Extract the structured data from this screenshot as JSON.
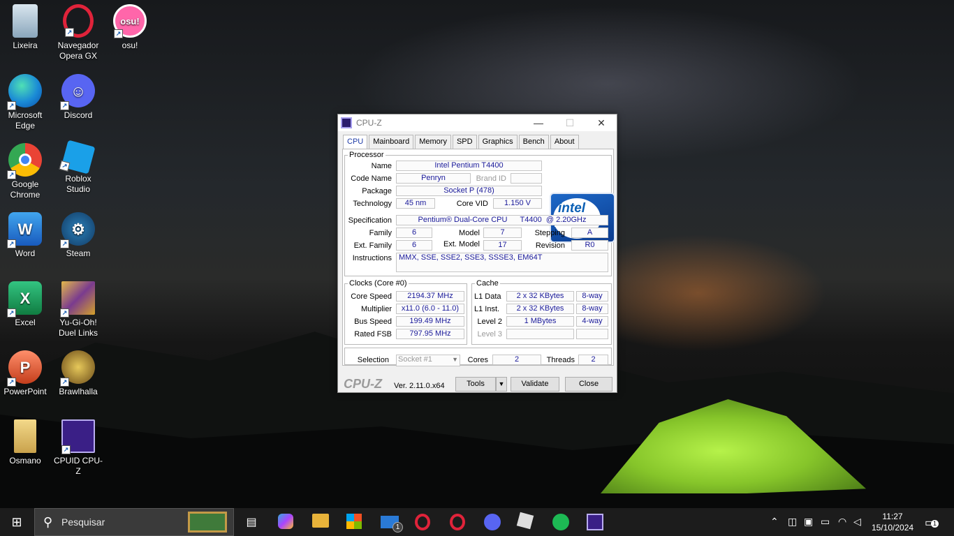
{
  "desktop": {
    "icons": [
      {
        "label": "Lixeira"
      },
      {
        "label": "Navegador Opera GX"
      },
      {
        "label": "osu!",
        "glyph": "osu!"
      },
      {
        "label": "Microsoft Edge"
      },
      {
        "label": "Discord"
      },
      {
        "label": "Google Chrome"
      },
      {
        "label": "Roblox Studio"
      },
      {
        "label": "Word",
        "glyph": "W"
      },
      {
        "label": "Steam"
      },
      {
        "label": "Excel",
        "glyph": "X"
      },
      {
        "label": "Yu-Gi-Oh! Duel Links"
      },
      {
        "label": "PowerPoint",
        "glyph": "P"
      },
      {
        "label": "Brawlhalla"
      },
      {
        "label": "Osmano"
      },
      {
        "label": "CPUID CPU-Z"
      }
    ]
  },
  "window": {
    "title": "CPU-Z",
    "controls": {
      "minimize": "—",
      "maximize": "☐",
      "close": "✕"
    },
    "tabs": [
      "CPU",
      "Mainboard",
      "Memory",
      "SPD",
      "Graphics",
      "Bench",
      "About"
    ],
    "processor": {
      "legend": "Processor",
      "name_label": "Name",
      "name": "Intel Pentium T4400",
      "codename_label": "Code Name",
      "codename": "Penryn",
      "brand_id_label": "Brand ID",
      "brand_id": "",
      "package_label": "Package",
      "package": "Socket P (478)",
      "technology_label": "Technology",
      "technology": "45 nm",
      "core_vid_label": "Core VID",
      "core_vid": "1.150 V",
      "spec_label": "Specification",
      "spec": "Pentium® Dual-Core CPU      T4400  @ 2.20GHz",
      "family_label": "Family",
      "family": "6",
      "model_label": "Model",
      "model": "7",
      "stepping_label": "Stepping",
      "stepping": "A",
      "ext_family_label": "Ext. Family",
      "ext_family": "6",
      "ext_model_label": "Ext. Model",
      "ext_model": "17",
      "revision_label": "Revision",
      "revision": "R0",
      "instructions_label": "Instructions",
      "instructions": "MMX, SSE, SSE2, SSE3, SSSE3, EM64T",
      "logo": {
        "line1": "intel",
        "line2": "Pentium",
        "line3": "inside",
        "color": "#0a5fb4"
      }
    },
    "clocks": {
      "legend": "Clocks (Core #0)",
      "core_speed_label": "Core Speed",
      "core_speed": "2194.37 MHz",
      "multiplier_label": "Multiplier",
      "multiplier": "x11.0 (6.0 - 11.0)",
      "bus_speed_label": "Bus Speed",
      "bus_speed": "199.49 MHz",
      "rated_fsb_label": "Rated FSB",
      "rated_fsb": "797.95 MHz"
    },
    "cache": {
      "legend": "Cache",
      "l1d_label": "L1 Data",
      "l1d": "2 x 32 KBytes",
      "l1d_way": "8-way",
      "l1i_label": "L1 Inst.",
      "l1i": "2 x 32 KBytes",
      "l1i_way": "8-way",
      "l2_label": "Level 2",
      "l2": "1 MBytes",
      "l2_way": "4-way",
      "l3_label": "Level 3"
    },
    "selection_label": "Selection",
    "selection": "Socket #1",
    "cores_label": "Cores",
    "cores": "2",
    "threads_label": "Threads",
    "threads": "2",
    "footer": {
      "logo": "CPU-Z",
      "version": "Ver. 2.11.0.x64",
      "tools": "Tools",
      "validate": "Validate",
      "close": "Close"
    }
  },
  "taskbar": {
    "search_placeholder": "Pesquisar",
    "mail_badge": "1",
    "time": "11:27",
    "date": "15/10/2024",
    "notification_count": "1"
  }
}
